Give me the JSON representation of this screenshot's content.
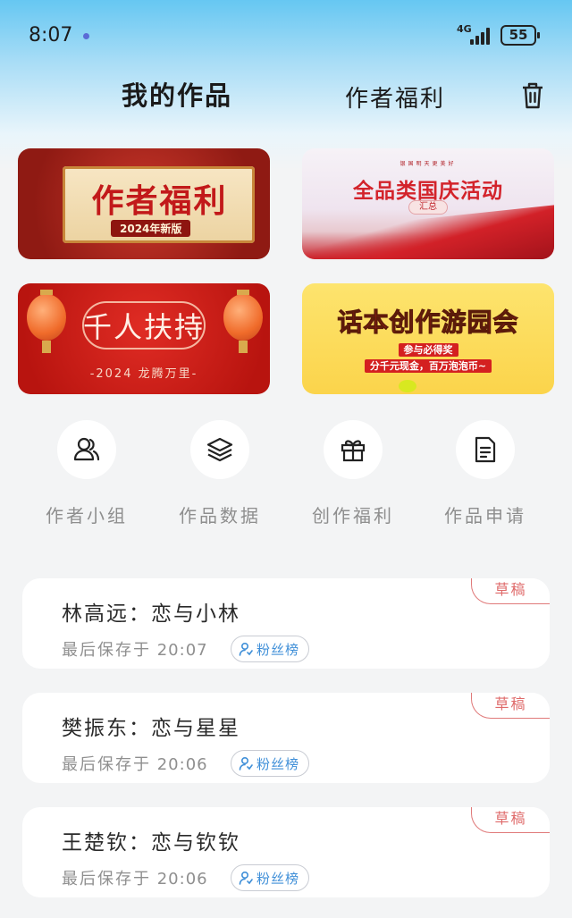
{
  "status": {
    "time": "8:07",
    "network": "4G",
    "battery": "55"
  },
  "header": {
    "tab_main": "我的作品",
    "tab_secondary": "作者福利",
    "trash_icon": "trash-icon"
  },
  "banners": [
    {
      "title": "作者福利",
      "sub": "2024年新版"
    },
    {
      "small": "银国明天更美好",
      "title": "全品类国庆活动",
      "sub": "汇总"
    },
    {
      "title": "千人扶持",
      "sub": "-2024 龙腾万里-"
    },
    {
      "title": "话本创作游园会",
      "line1": "参与必得奖",
      "line2": "分千元现金，百万泡泡币~"
    }
  ],
  "quick_actions": [
    {
      "label": "作者小组",
      "icon": "group-icon"
    },
    {
      "label": "作品数据",
      "icon": "layers-icon"
    },
    {
      "label": "创作福利",
      "icon": "gift-icon"
    },
    {
      "label": "作品申请",
      "icon": "document-icon"
    }
  ],
  "works": [
    {
      "title": "林高远：恋与小林",
      "saved_label": "最后保存于",
      "saved_time": "20:07",
      "fans_label": "粉丝榜",
      "status": "草稿"
    },
    {
      "title": "樊振东：恋与星星",
      "saved_label": "最后保存于",
      "saved_time": "20:06",
      "fans_label": "粉丝榜",
      "status": "草稿"
    },
    {
      "title": "王楚钦：恋与钦钦",
      "saved_label": "最后保存于",
      "saved_time": "20:06",
      "fans_label": "粉丝榜",
      "status": "草稿"
    }
  ],
  "colors": {
    "accent_blue": "#3f8fd8",
    "draft_red": "#df6a6a"
  }
}
